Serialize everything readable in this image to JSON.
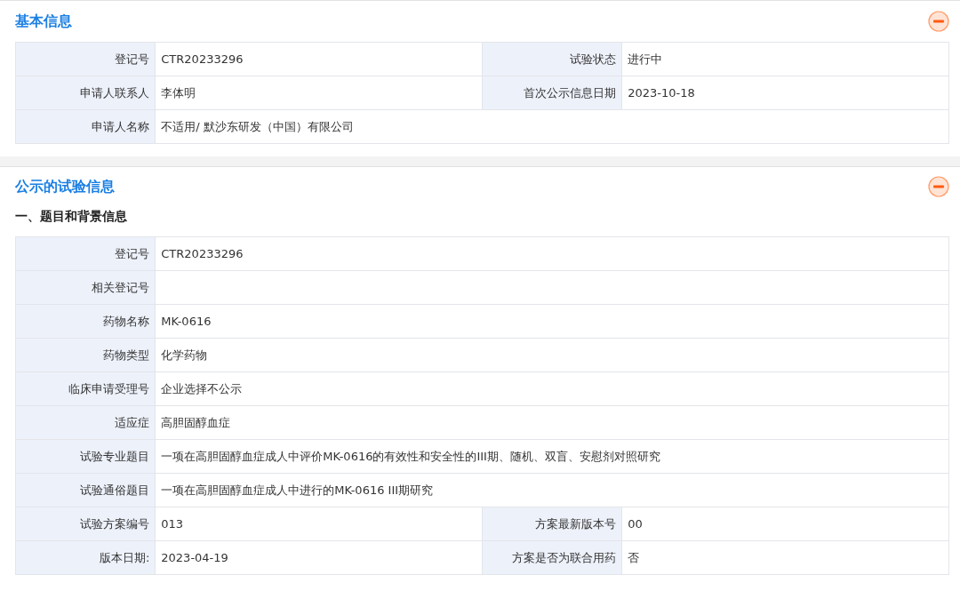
{
  "sections": [
    {
      "title": "基本信息",
      "expanded": true,
      "groups": [
        {
          "rows": [
            [
              {
                "label": "登记号",
                "value": "CTR20233296"
              },
              {
                "label": "试验状态",
                "value": "进行中"
              }
            ],
            [
              {
                "label": "申请人联系人",
                "value": "李体明"
              },
              {
                "label": "首次公示信息日期",
                "value": "2023-10-18"
              }
            ],
            [
              {
                "label": "申请人名称",
                "value": "不适用/ 默沙东研发（中国）有限公司"
              }
            ]
          ]
        }
      ]
    },
    {
      "title": "公示的试验信息",
      "expanded": true,
      "groups": [
        {
          "heading": "一、题目和背景信息",
          "rows": [
            [
              {
                "label": "登记号",
                "value": "CTR20233296"
              }
            ],
            [
              {
                "label": "相关登记号"
              }
            ],
            [
              {
                "label": "药物名称",
                "value": "MK-0616"
              }
            ],
            [
              {
                "label": "药物类型",
                "value": "化学药物"
              }
            ],
            [
              {
                "label": "临床申请受理号",
                "value": "企业选择不公示"
              }
            ],
            [
              {
                "label": "适应症",
                "value": "高胆固醇血症"
              }
            ],
            [
              {
                "label": "试验专业题目",
                "value": "一项在高胆固醇血症成人中评价MK-0616的有效性和安全性的III期、随机、双盲、安慰剂对照研究"
              }
            ],
            [
              {
                "label": "试验通俗题目",
                "value": "一项在高胆固醇血症成人中进行的MK-0616 III期研究"
              }
            ],
            [
              {
                "label": "试验方案编号",
                "value": "013"
              },
              {
                "label": "方案最新版本号",
                "value": "00"
              }
            ],
            [
              {
                "label": "版本日期:",
                "value": "2023-04-19"
              },
              {
                "label": "方案是否为联合用药",
                "value": "否"
              }
            ]
          ]
        }
      ]
    }
  ]
}
